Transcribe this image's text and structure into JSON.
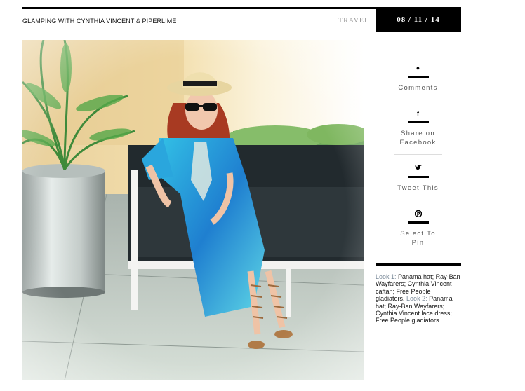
{
  "header": {
    "title": "GLAMPING WITH CYNTHIA VINCENT & PIPERLIME",
    "category": "TRAVEL",
    "date": "08 / 11 / 14"
  },
  "share": {
    "items": [
      {
        "label": "Comments",
        "icon": "comment-icon",
        "glyph": "●"
      },
      {
        "label": "Share on Facebook",
        "icon": "facebook-icon",
        "glyph": "f"
      },
      {
        "label": "Tweet This",
        "icon": "twitter-icon",
        "glyph": "🐦"
      },
      {
        "label": "Select To Pin",
        "icon": "pinterest-icon",
        "glyph": "P"
      }
    ]
  },
  "caption": {
    "look1_label": "Look 1:",
    "look1_text": " Panama hat; Ray-Ban Wayfarers; Cynthia Vincent caftan; Free People gladiators.",
    "look2_label": "Look 2:",
    "look2_text": " Panama hat; Ray-Ban Wayfarers; Cynthia Vincent lace dress; Free People gladiators."
  },
  "colors": {
    "accent": "#000000",
    "muted": "#9a9a9a",
    "look_label": "#7a8a99"
  }
}
